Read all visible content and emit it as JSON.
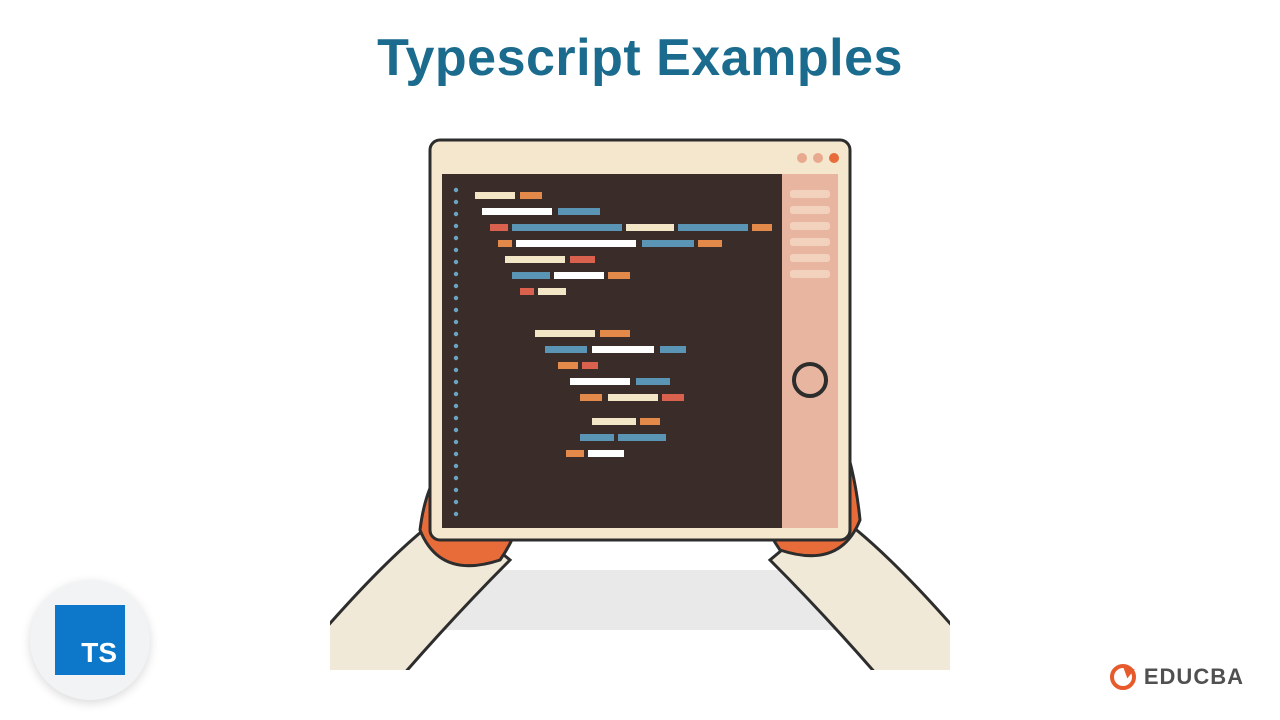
{
  "title": "Typescript Examples",
  "ts_badge_text": "TS",
  "brand_text": "EDUCBA",
  "colors": {
    "title": "#1a6b8e",
    "ts_blue": "#0d78c9",
    "brand_orange": "#e65a2b",
    "editor_bg": "#3a2c29",
    "tablet_frame": "#f5e7ce",
    "tablet_side": "#e8b6a0",
    "hand": "#e86c3a",
    "sleeve": "#f1e9d8",
    "dot_guide": "#6aa7c6",
    "code_cream": "#f3e6c6",
    "code_white": "#ffffff",
    "code_blue": "#5b95b5",
    "code_orange": "#e38a4a",
    "code_red": "#d9614e",
    "shadow": "#e9e9e9"
  },
  "window_dots": [
    "#e8a98f",
    "#e8a98f",
    "#e86c3a"
  ]
}
